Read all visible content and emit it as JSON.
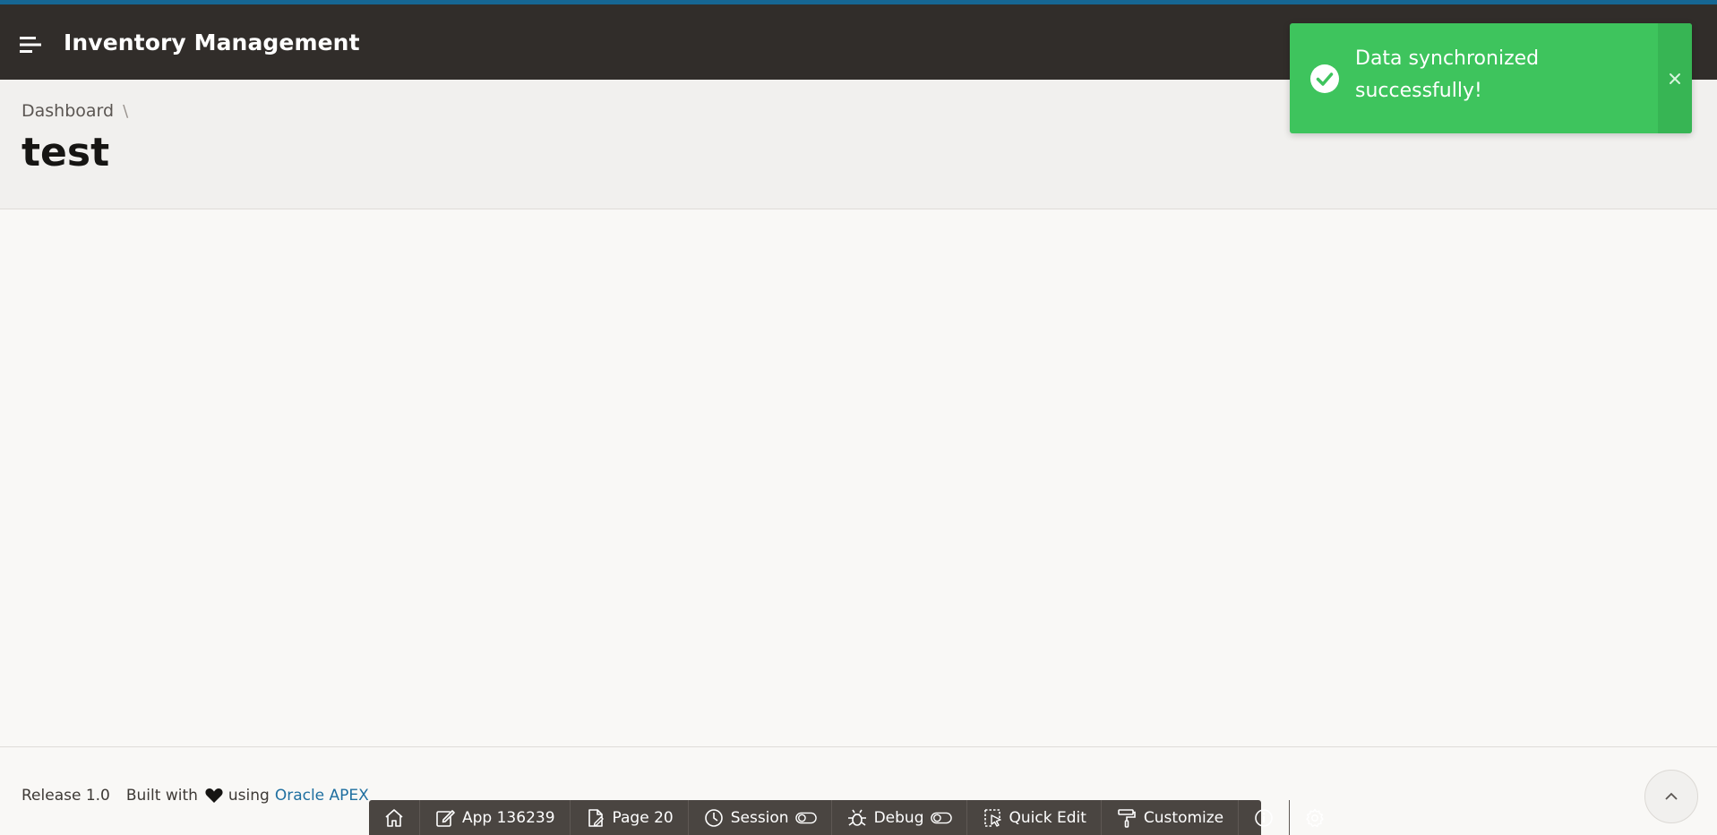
{
  "header": {
    "app_title": "Inventory Management"
  },
  "breadcrumb": {
    "items": [
      "Dashboard"
    ],
    "separator": "\\"
  },
  "page": {
    "title": "test"
  },
  "toast": {
    "message": "Data synchronized successfully!",
    "color": "#3ec45d"
  },
  "footer": {
    "release": "Release 1.0",
    "built_with": "Built with",
    "using": "using",
    "link_text": "Oracle APEX"
  },
  "devbar": {
    "home_icon": "home-icon",
    "app_label": "App 136239",
    "page_label": "Page 20",
    "session_label": "Session",
    "debug_label": "Debug",
    "quick_edit_label": "Quick Edit",
    "customize_label": "Customize"
  },
  "colors": {
    "accent": "#166693",
    "header_bg": "#312d2a",
    "link": "#1f6fa0"
  }
}
